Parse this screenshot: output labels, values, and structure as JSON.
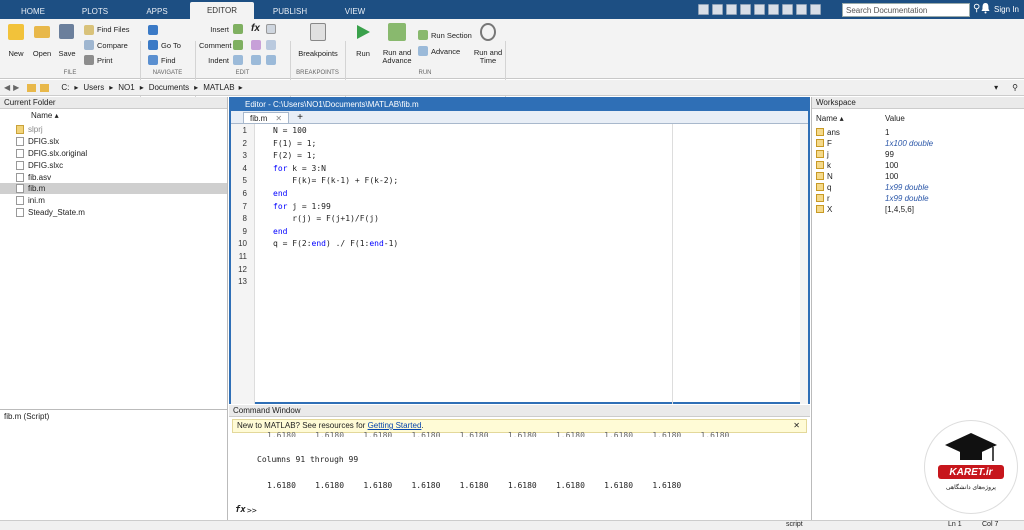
{
  "tabs": [
    "HOME",
    "PLOTS",
    "APPS",
    "EDITOR",
    "PUBLISH",
    "VIEW"
  ],
  "search_placeholder": "Search Documentation",
  "signin": "Sign In",
  "ribbon": {
    "new": "New",
    "open": "Open",
    "save": "Save",
    "find_files": "Find Files",
    "compare": "Compare",
    "print": "Print",
    "goto": "Go To",
    "find": "Find",
    "insert": "Insert",
    "comment": "Comment",
    "indent": "Indent",
    "breakpoints": "Breakpoints",
    "run": "Run",
    "run_advance": "Run and\nAdvance",
    "run_section": "Run Section",
    "advance": "Advance",
    "run_time": "Run and\nTime",
    "sections": [
      "FILE",
      "NAVIGATE",
      "EDIT",
      "BREAKPOINTS",
      "RUN"
    ]
  },
  "path": [
    "C:",
    "Users",
    "NO1",
    "Documents",
    "MATLAB"
  ],
  "current_folder": {
    "title": "Current Folder",
    "col": "Name ▴",
    "files": [
      "slprj",
      "DFIG.slx",
      "DFIG.slx.original",
      "DFIG.slxc",
      "fib.asv",
      "fib.m",
      "ini.m",
      "Steady_State.m"
    ],
    "details": "fib.m  (Script)"
  },
  "editor": {
    "title": "Editor - C:\\Users\\NO1\\Documents\\MATLAB\\fib.m",
    "tab": "fib.m",
    "lines": [
      "N = 100",
      "F(1) = 1;",
      "F(2) = 1;",
      "for k = 3:N",
      "    F(k)= F(k-1) + F(k-2);",
      "end",
      "for j = 1:99",
      "    r(j) = F(j+1)/F(j)",
      "end",
      "q = F(2:end) ./ F(1:end-1)",
      "",
      "",
      ""
    ]
  },
  "command": {
    "title": "Command Window",
    "tip": "New to MATLAB? See resources for ",
    "tip_link": "Getting Started",
    "tip_end": ".",
    "row_partial": "1.6180    1.6180    1.6180    1.6180    1.6180    1.6180    1.6180    1.6180    1.6180    1.6180",
    "columns": "Columns 91 through 99",
    "row": "1.6180    1.6180    1.6180    1.6180    1.6180    1.6180    1.6180    1.6180    1.6180",
    "prompt": ">>"
  },
  "workspace": {
    "title": "Workspace",
    "cols": [
      "Name ▴",
      "Value"
    ],
    "vars": [
      {
        "name": "ans",
        "value": "1"
      },
      {
        "name": "F",
        "value": "1x100 double"
      },
      {
        "name": "j",
        "value": "99"
      },
      {
        "name": "k",
        "value": "100"
      },
      {
        "name": "N",
        "value": "100"
      },
      {
        "name": "q",
        "value": "1x99 double"
      },
      {
        "name": "r",
        "value": "1x99 double"
      },
      {
        "name": "X",
        "value": "[1,4,5,6]"
      }
    ]
  },
  "status": {
    "mode": "script",
    "ln": "Ln  1",
    "col": "Col  7"
  },
  "logo": {
    "name": "KARET.ir",
    "sub": "پروژه‌های دانشگاهی"
  }
}
